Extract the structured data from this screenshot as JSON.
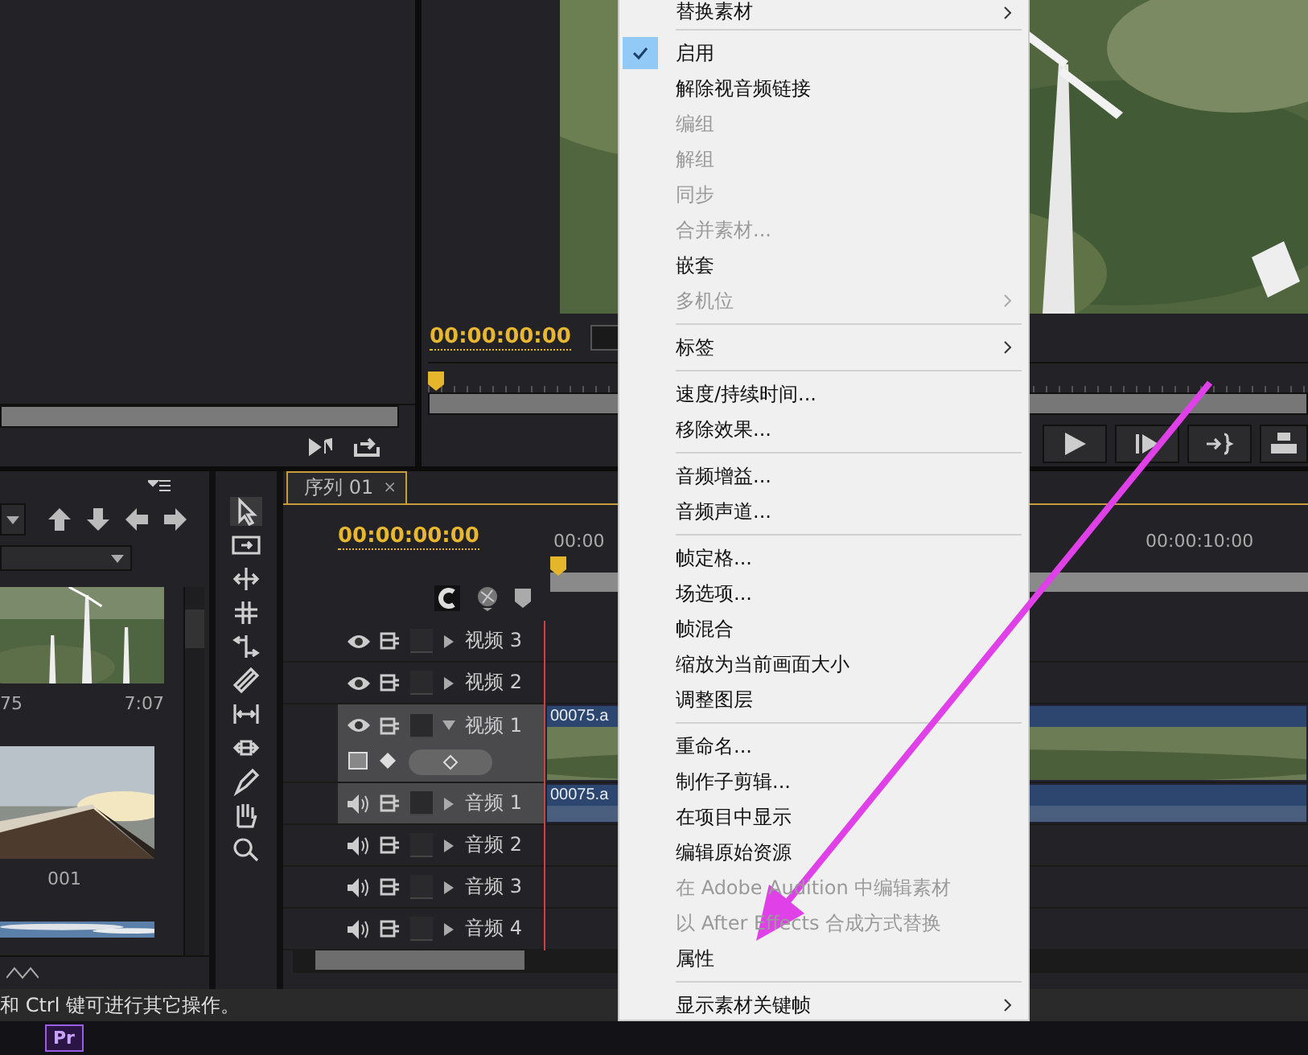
{
  "program_monitor": {
    "timecode": "00:00:00:00"
  },
  "project_bin": {
    "items": [
      {
        "kind": "picture",
        "name": "75",
        "duration": "7:07"
      },
      {
        "kind": "picture",
        "name": "001"
      },
      {
        "kind": "picture"
      }
    ]
  },
  "timeline": {
    "tab": "序列 01",
    "close": "×",
    "timecode": "00:00:00:00",
    "ruler": [
      "00:00",
      "00:00:10:00"
    ],
    "tracks": [
      {
        "kind": "video",
        "label": "视频 3",
        "selected": false,
        "expanded": false
      },
      {
        "kind": "video",
        "label": "视频 2",
        "selected": false,
        "expanded": false
      },
      {
        "kind": "video",
        "label": "视频 1",
        "selected": true,
        "expanded": true,
        "clip": "00075.a"
      },
      {
        "kind": "audio",
        "label": "音频 1",
        "selected": true,
        "expanded": false,
        "clip": "00075.a"
      },
      {
        "kind": "audio",
        "label": "音频 2",
        "selected": false,
        "expanded": false
      },
      {
        "kind": "audio",
        "label": "音频 3",
        "selected": false,
        "expanded": false
      },
      {
        "kind": "audio",
        "label": "音频 4",
        "selected": false,
        "expanded": false
      }
    ]
  },
  "status_bar": "和 Ctrl 键可进行其它操作。",
  "taskbar": {
    "app_icon": "Pr"
  },
  "context_menu": {
    "groups": [
      {
        "items": [
          {
            "label": "替换素材",
            "checked": false,
            "disabled": false,
            "submenu": true
          }
        ]
      },
      {
        "items": [
          {
            "label": "启用",
            "checked": true,
            "disabled": false,
            "submenu": false
          },
          {
            "label": "解除视音频链接",
            "checked": false,
            "disabled": false,
            "submenu": false
          },
          {
            "label": "编组",
            "checked": false,
            "disabled": true,
            "submenu": false
          },
          {
            "label": "解组",
            "checked": false,
            "disabled": true,
            "submenu": false
          },
          {
            "label": "同步",
            "checked": false,
            "disabled": true,
            "submenu": false
          },
          {
            "label": "合并素材...",
            "checked": false,
            "disabled": true,
            "submenu": false
          },
          {
            "label": "嵌套",
            "checked": false,
            "disabled": false,
            "submenu": false
          },
          {
            "label": "多机位",
            "checked": false,
            "disabled": true,
            "submenu": true
          }
        ]
      },
      {
        "items": [
          {
            "label": "标签",
            "checked": false,
            "disabled": false,
            "submenu": true
          }
        ]
      },
      {
        "items": [
          {
            "label": "速度/持续时间...",
            "checked": false,
            "disabled": false,
            "submenu": false
          },
          {
            "label": "移除效果...",
            "checked": false,
            "disabled": false,
            "submenu": false
          }
        ]
      },
      {
        "items": [
          {
            "label": "音频增益...",
            "checked": false,
            "disabled": false,
            "submenu": false
          },
          {
            "label": "音频声道...",
            "checked": false,
            "disabled": false,
            "submenu": false
          }
        ]
      },
      {
        "items": [
          {
            "label": "帧定格...",
            "checked": false,
            "disabled": false,
            "submenu": false
          },
          {
            "label": "场选项...",
            "checked": false,
            "disabled": false,
            "submenu": false
          },
          {
            "label": "帧混合",
            "checked": false,
            "disabled": false,
            "submenu": false
          },
          {
            "label": "缩放为当前画面大小",
            "checked": false,
            "disabled": false,
            "submenu": false
          },
          {
            "label": "调整图层",
            "checked": false,
            "disabled": false,
            "submenu": false
          }
        ]
      },
      {
        "items": [
          {
            "label": "重命名...",
            "checked": false,
            "disabled": false,
            "submenu": false
          },
          {
            "label": "制作子剪辑...",
            "checked": false,
            "disabled": false,
            "submenu": false
          },
          {
            "label": "在项目中显示",
            "checked": false,
            "disabled": false,
            "submenu": false
          },
          {
            "label": "编辑原始资源",
            "checked": false,
            "disabled": false,
            "submenu": false
          },
          {
            "label": "在 Adobe Audition 中编辑素材",
            "checked": false,
            "disabled": true,
            "submenu": false
          },
          {
            "label": "以 After Effects 合成方式替换",
            "checked": false,
            "disabled": true,
            "submenu": false
          },
          {
            "label": "属性",
            "checked": false,
            "disabled": false,
            "submenu": false
          }
        ]
      },
      {
        "items": [
          {
            "label": "显示素材关键帧",
            "checked": false,
            "disabled": false,
            "submenu": true
          }
        ]
      }
    ]
  }
}
